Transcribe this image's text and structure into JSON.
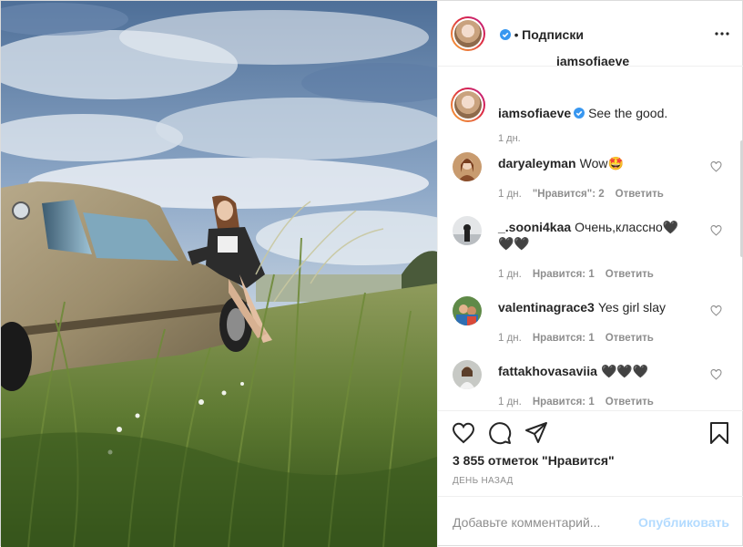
{
  "post": {
    "author": "iamsofiaeve",
    "separator": "•",
    "follow_label": "Подписки",
    "caption": "See the good.",
    "caption_time": "1 дн."
  },
  "comments": [
    {
      "user": "daryaleyman",
      "text": "Wow🤩",
      "time": "1 дн.",
      "likes": "\"Нравится\": 2",
      "reply": "Ответить"
    },
    {
      "user": "_.sooni4kaa",
      "text": "Очень,классно🖤🖤🖤",
      "time": "1 дн.",
      "likes": "Нравится: 1",
      "reply": "Ответить"
    },
    {
      "user": "valentinagrace3",
      "text": "Yes girl slay",
      "time": "1 дн.",
      "likes": "Нравится: 1",
      "reply": "Ответить"
    },
    {
      "user": "fattakhovasaviia",
      "text": "🖤🖤🖤",
      "time": "1 дн.",
      "likes": "Нравится: 1",
      "reply": "Ответить"
    }
  ],
  "actions": {
    "likes_count": "3 855 отметок \"Нравится\"",
    "age": "ДЕНЬ НАЗАД"
  },
  "composer": {
    "placeholder": "Добавьте комментарий...",
    "publish_label": "Опубликовать"
  },
  "colors": {
    "verified": "#3897f0",
    "publish_disabled": "#b3dbff",
    "secondary_text": "#8e8e8e"
  },
  "icons": [
    "more-icon",
    "verified-icon",
    "heart-icon",
    "comment-icon",
    "share-icon",
    "bookmark-icon"
  ]
}
